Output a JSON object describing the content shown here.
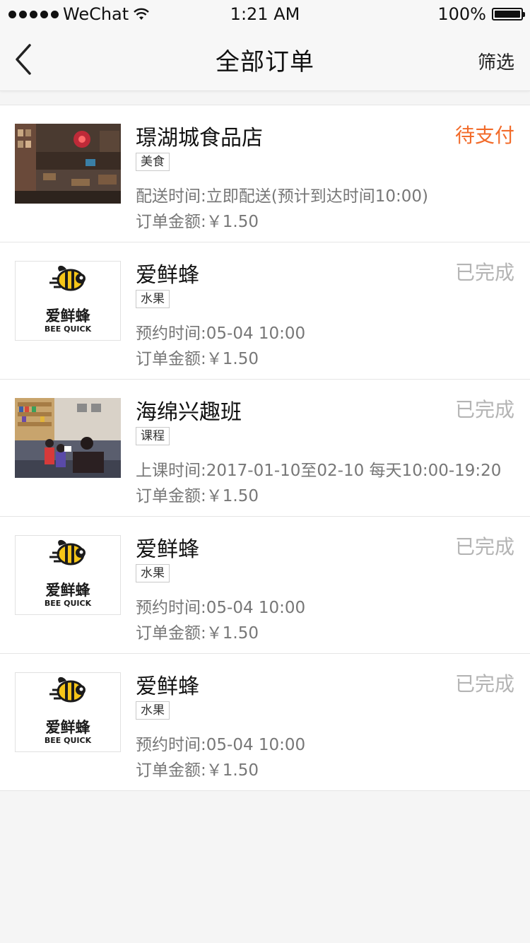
{
  "status_bar": {
    "carrier": "WeChat",
    "time": "1:21 AM",
    "battery": "100%"
  },
  "nav": {
    "title": "全部订单",
    "filter_label": "筛选"
  },
  "colors": {
    "status_pending": "#f26b2a",
    "status_done": "#b4b4b4"
  },
  "orders": [
    {
      "shop": "璟湖城食品店",
      "status": "待支付",
      "status_type": "pending",
      "tag": "美食",
      "detail": "配送时间:立即配送(预计到达时间10:00)",
      "price": "订单金额:￥1.50",
      "thumb": "restaurant-photo"
    },
    {
      "shop": "爱鲜蜂",
      "status": "已完成",
      "status_type": "done",
      "tag": "水果",
      "detail": "预约时间:05-04 10:00",
      "price": "订单金额:￥1.50",
      "thumb": "beequick-logo",
      "logo_cn": "爱鲜蜂",
      "logo_en": "BEE QUICK"
    },
    {
      "shop": "海绵兴趣班",
      "status": "已完成",
      "status_type": "done",
      "tag": "课程",
      "detail": "上课时间:2017-01-10至02-10 每天10:00-19:20",
      "price": "订单金额:￥1.50",
      "thumb": "classroom-photo"
    },
    {
      "shop": "爱鲜蜂",
      "status": "已完成",
      "status_type": "done",
      "tag": "水果",
      "detail": "预约时间:05-04 10:00",
      "price": "订单金额:￥1.50",
      "thumb": "beequick-logo",
      "logo_cn": "爱鲜蜂",
      "logo_en": "BEE QUICK"
    },
    {
      "shop": "爱鲜蜂",
      "status": "已完成",
      "status_type": "done",
      "tag": "水果",
      "detail": "预约时间:05-04 10:00",
      "price": "订单金额:￥1.50",
      "thumb": "beequick-logo",
      "logo_cn": "爱鲜蜂",
      "logo_en": "BEE QUICK"
    }
  ]
}
